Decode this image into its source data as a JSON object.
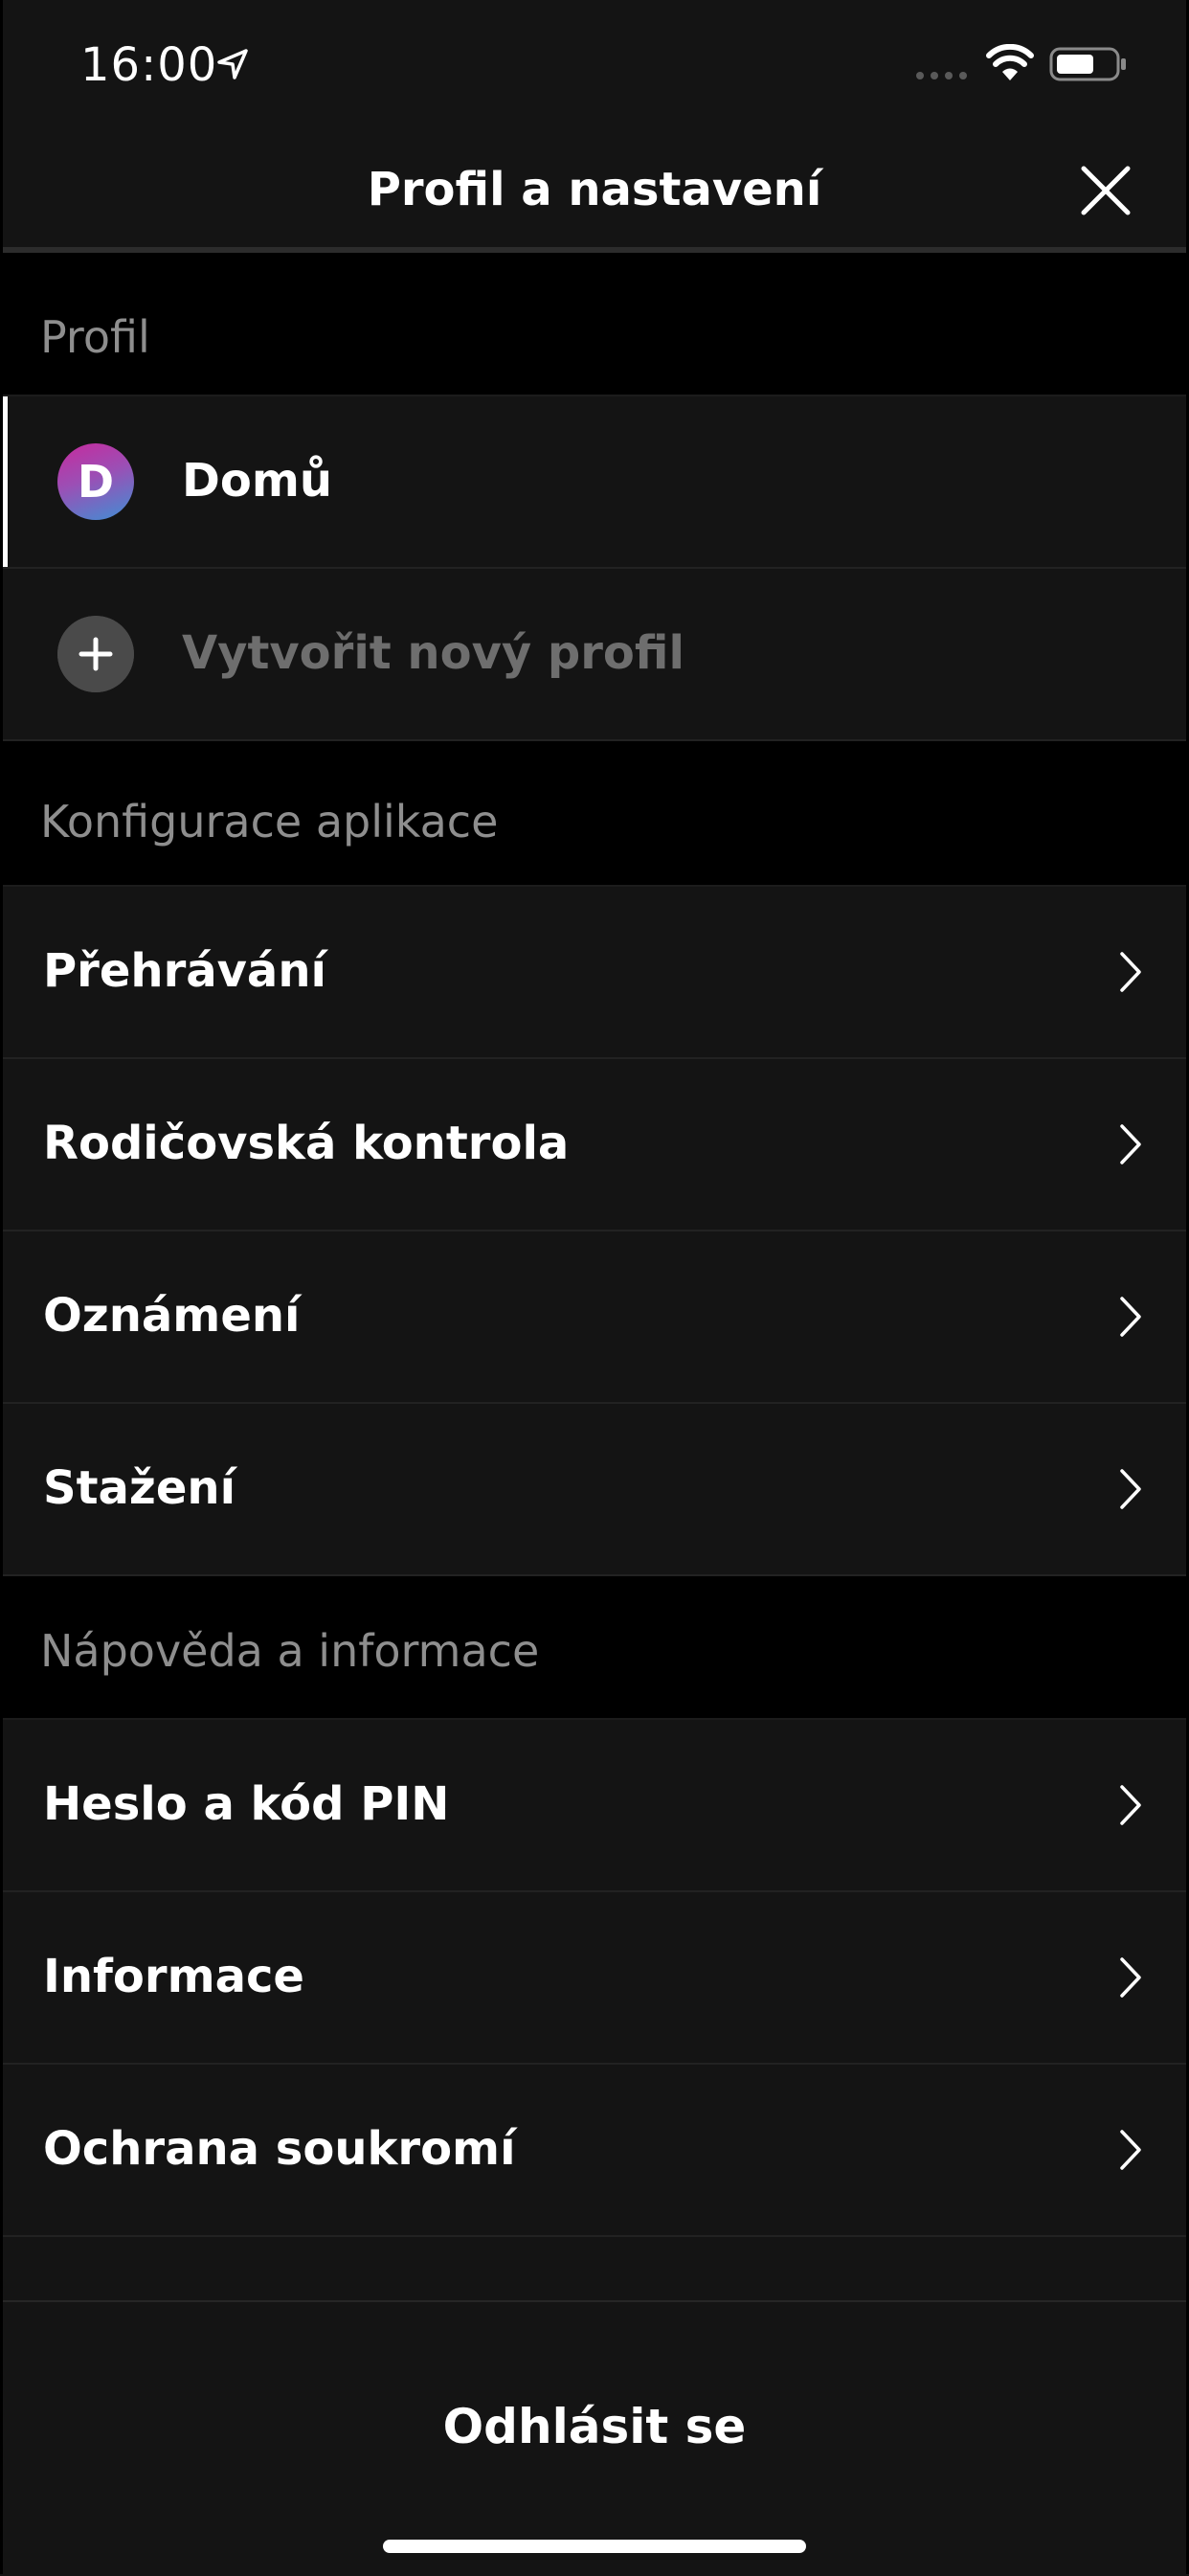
{
  "status_bar": {
    "time": "16:00"
  },
  "header": {
    "title": "Profil a nastavení",
    "close_icon": "close-icon"
  },
  "sections": {
    "profile": {
      "title": "Profil"
    },
    "app_config": {
      "title": "Konfigurace aplikace"
    },
    "help": {
      "title": "Nápověda a informace"
    }
  },
  "profiles": [
    {
      "initial": "D",
      "name": "Domů",
      "active": true
    },
    {
      "name": "Vytvořit nový profil"
    }
  ],
  "app_config_items": [
    "Přehrávání",
    "Rodičovská kontrola",
    "Oznámení",
    "Stažení"
  ],
  "help_items": [
    "Heslo a kód PIN",
    "Informace",
    "Ochrana soukromí"
  ],
  "footer": {
    "logout": "Odhlásit se"
  },
  "colors": {
    "background": "#141414",
    "section_background": "#000000",
    "section_text": "#8e8e8e",
    "muted_text": "#6e6e6e",
    "avatar_gradient": [
      "#c72a9d",
      "#3f8fd4"
    ]
  }
}
